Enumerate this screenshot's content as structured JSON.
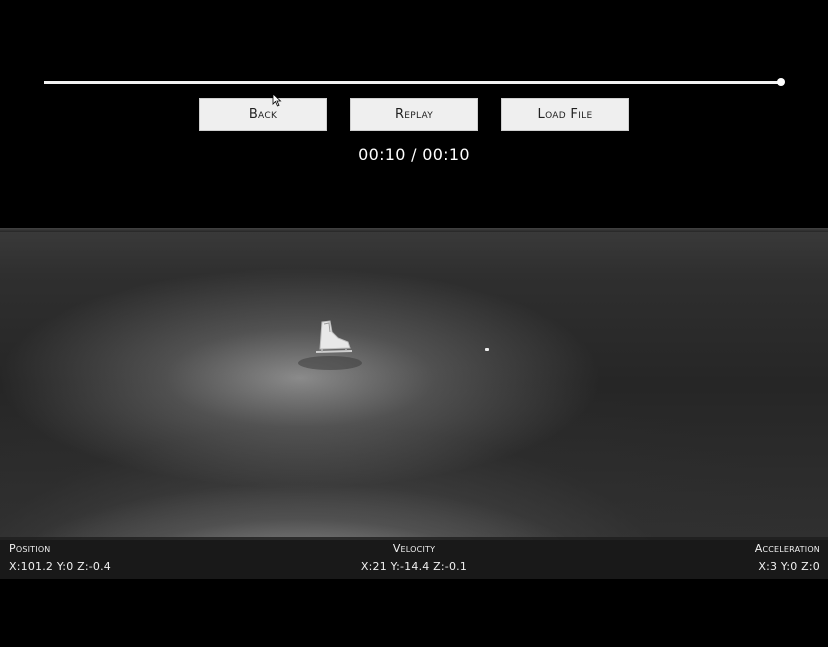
{
  "playback": {
    "progress": 1.0,
    "time_display": "00:10 / 00:10"
  },
  "buttons": {
    "back_label": "Back",
    "replay_label": "Replay",
    "load_file_label": "Load File"
  },
  "telemetry": {
    "position_label": "Position",
    "position_value": "X:101.2 Y:0 Z:-0.4",
    "velocity_label": "Velocity",
    "velocity_value": "X:21 Y:-14.4 Z:-0.1",
    "acceleration_label": "Acceleration",
    "acceleration_value": "X:3 Y:0 Z:0"
  },
  "icons": {
    "cursor": "mouse-pointer-icon",
    "skate": "ice-skate-icon"
  },
  "colors": {
    "background": "#000000",
    "button_bg": "#efefef",
    "text": "#ffffff"
  }
}
